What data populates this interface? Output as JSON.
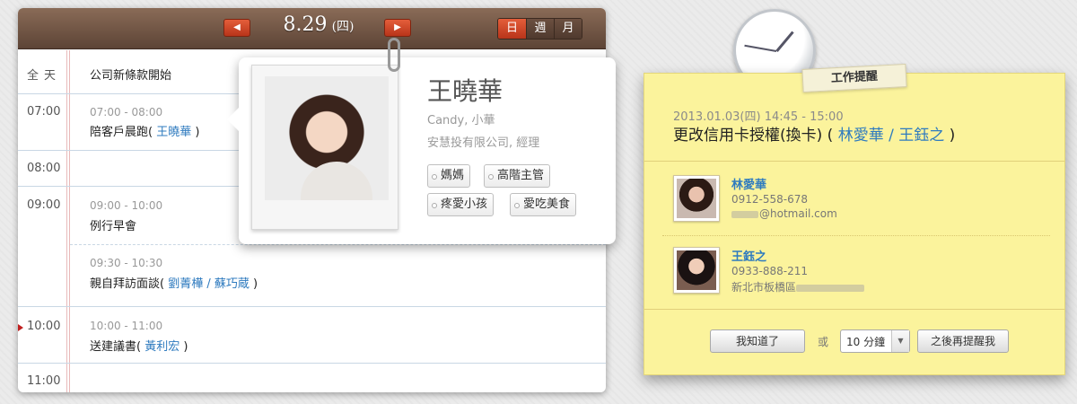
{
  "calendar": {
    "nav_prev": "◀",
    "nav_next": "▶",
    "date": "8.29",
    "weekday": "(四)",
    "views": [
      "日",
      "週",
      "月"
    ],
    "active_view": "日",
    "rows": {
      "allday_label": "全天",
      "allday_event": "公司新條款開始",
      "t0700": "07:00",
      "t0800": "08:00",
      "t0900": "09:00",
      "t1000": "10:00",
      "t1100": "11:00"
    },
    "events": [
      {
        "time": "07:00 - 08:00",
        "title": "陪客戶晨跑(",
        "people": [
          "王曉華"
        ],
        "close": ")"
      },
      {
        "time": "09:00 - 10:00",
        "title": "例行早會"
      },
      {
        "time": "09:30 - 10:30",
        "title": "親自拜訪面談(",
        "people": [
          "劉菁樺",
          "蘇巧蔵"
        ],
        "close": ")"
      },
      {
        "time": "10:00 - 11:00",
        "title": "送建議書(",
        "people": [
          "黃利宏"
        ],
        "close": ")"
      }
    ]
  },
  "profile": {
    "name": "王曉華",
    "nickname": "Candy, 小華",
    "org": "安慧投有限公司, 經理",
    "tags": [
      "媽媽",
      "高階主管",
      "疼愛小孩",
      "愛吃美食"
    ]
  },
  "reminder": {
    "tab_label": "工作提醒",
    "datetime": "2013.01.03(四)  14:45 - 15:00",
    "title_prefix": "更改信用卡授權(換卡) (",
    "people": [
      "林愛華",
      "王鈺之"
    ],
    "title_suffix": ")",
    "contacts": [
      {
        "name": "林愛華",
        "phone": "0912-558-678",
        "extra": "@hotmail.com"
      },
      {
        "name": "王鈺之",
        "phone": "0933-888-211",
        "extra": "新北市板橋區"
      }
    ],
    "ack_label": "我知道了",
    "or_label": "或",
    "snooze_value": "10 分鐘",
    "snooze_caret": "▼",
    "later_label": "之後再提醒我"
  },
  "colors": {
    "accent": "#d84a28",
    "header_brown": "#6b4f40",
    "link": "#2f7bbf",
    "note_yellow": "#fbf39c"
  },
  "icons": {
    "prev": "left-arrow-icon",
    "next": "right-arrow-icon",
    "clock": "clock-icon",
    "paperclip": "paperclip-icon"
  }
}
